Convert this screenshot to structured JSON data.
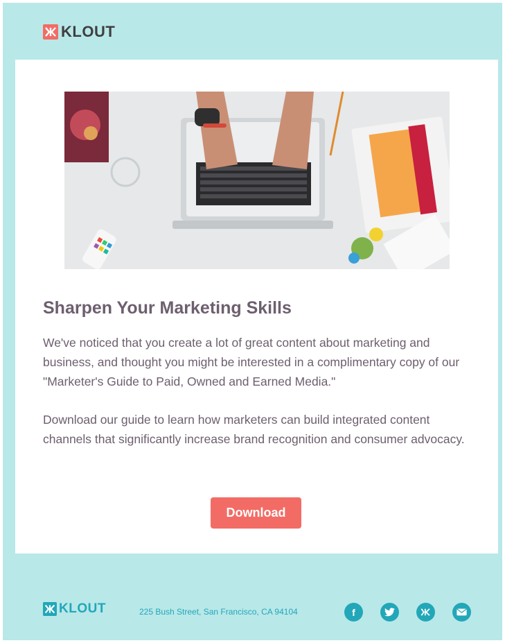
{
  "brand": {
    "name": "KLOUT",
    "accent": "#f26c65",
    "teal": "#22a7b8",
    "background": "#b9e8e9",
    "text": "#6d5f6e"
  },
  "hero": {
    "icon": "workspace-laptop-photo"
  },
  "article": {
    "headline": "Sharpen Your Marketing Skills",
    "paragraph1": "We've noticed that you create a lot of great content about marketing and business, and thought you might be interested in a complimentary copy of our \"Marketer's Guide to Paid, Owned and Earned Media.\"",
    "paragraph2": "Download our guide to learn how marketers can build integrated content channels that significantly increase brand recognition and consumer advocacy.",
    "button_label": "Download"
  },
  "footer": {
    "brand": "KLOUT",
    "address": "225 Bush Street, San Francisco, CA 94104",
    "social": [
      {
        "icon": "facebook-icon",
        "glyph": "f"
      },
      {
        "icon": "twitter-icon",
        "glyph": "t"
      },
      {
        "icon": "klout-icon",
        "glyph": "K"
      },
      {
        "icon": "email-icon",
        "glyph": "✉"
      }
    ]
  }
}
